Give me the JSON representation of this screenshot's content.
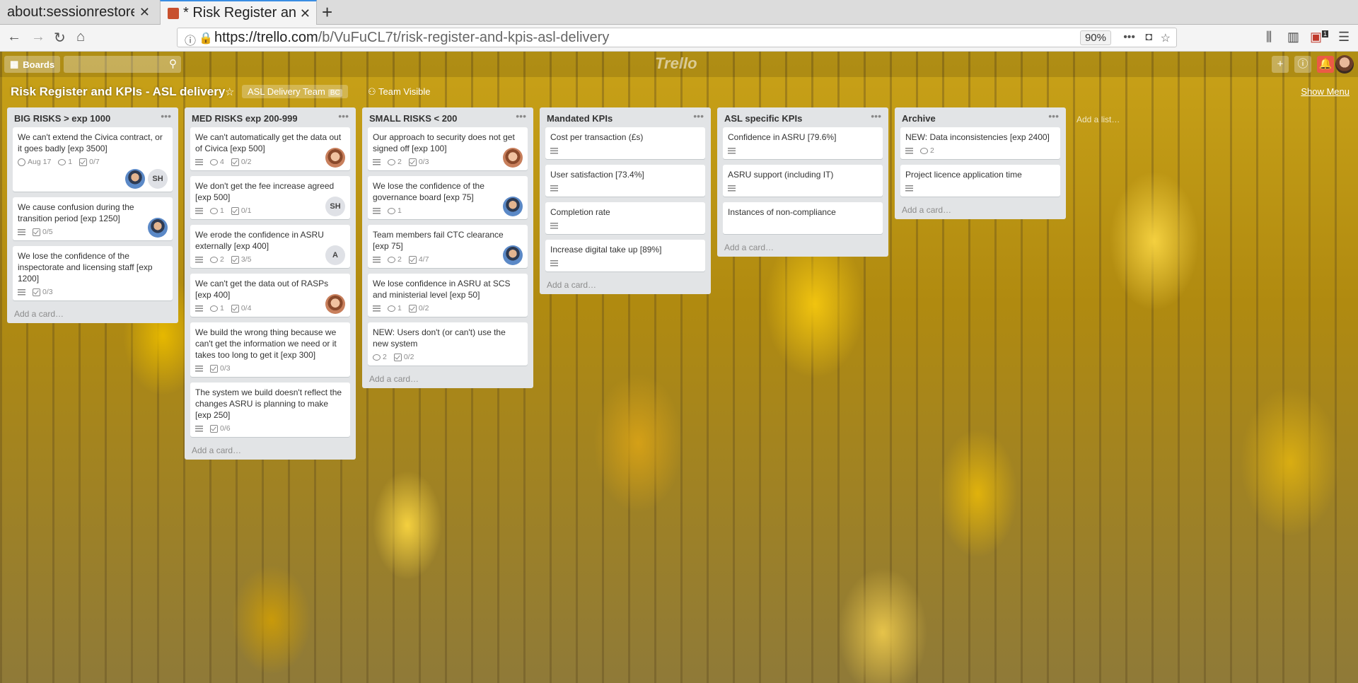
{
  "browser": {
    "tabs": [
      {
        "label": "about:sessionrestore",
        "active": false
      },
      {
        "label": "* Risk Register and KPIs - ASL delivery | Trello",
        "active": true
      }
    ],
    "url_host": "https://trello.com",
    "url_path": "/b/VuFuCL7t/risk-register-and-kpis-asl-delivery",
    "zoom": "90%",
    "extension_badge": "1"
  },
  "header": {
    "boards_label": "Boards",
    "logo": "Trello"
  },
  "board": {
    "title": "Risk Register and KPIs - ASL delivery",
    "team": "ASL Delivery Team",
    "team_tag": "BC",
    "visibility": "Team Visible",
    "show_menu": "Show Menu",
    "add_list": "Add a list…"
  },
  "lists": [
    {
      "name": "BIG RISKS > exp 1000",
      "add_card": "Add a card…",
      "cards": [
        {
          "title": "We can't extend the Civica contract, or it goes badly [exp 3500]",
          "due": "Aug 17",
          "comments": "1",
          "checklist": "0/7",
          "members": [
            "blue",
            "SH"
          ]
        },
        {
          "title": "We cause confusion during the transition period [exp 1250]",
          "desc": true,
          "checklist": "0/5",
          "members": [
            "blue"
          ]
        },
        {
          "title": "We lose the confidence of the inspectorate and licensing staff [exp 1200]",
          "desc": true,
          "checklist": "0/3",
          "members": []
        }
      ]
    },
    {
      "name": "MED RISKS exp 200-999",
      "add_card": "Add a card…",
      "cards": [
        {
          "title": "We can't automatically get the data out of Civica [exp 500]",
          "desc": true,
          "comments": "4",
          "checklist": "0/2",
          "members": [
            "warm"
          ]
        },
        {
          "title": "We don't get the fee increase agreed [exp 500]",
          "desc": true,
          "comments": "1",
          "checklist": "0/1",
          "members": [
            "SH"
          ]
        },
        {
          "title": "We erode the confidence in ASRU externally [exp 400]",
          "desc": true,
          "comments": "2",
          "checklist": "3/5",
          "members": [
            "A"
          ]
        },
        {
          "title": "We can't get the data out of RASPs [exp 400]",
          "desc": true,
          "comments": "1",
          "checklist": "0/4",
          "members": [
            "warm"
          ]
        },
        {
          "title": "We build the wrong thing because we can't get the information we need or it takes too long to get it [exp 300]",
          "desc": true,
          "checklist": "0/3",
          "members": []
        },
        {
          "title": "The system we build doesn't reflect the changes ASRU is planning to make [exp 250]",
          "desc": true,
          "checklist": "0/6",
          "members": []
        }
      ]
    },
    {
      "name": "SMALL RISKS < 200",
      "add_card": "Add a card…",
      "cards": [
        {
          "title": "Our approach to security does not get signed off [exp 100]",
          "desc": true,
          "comments": "2",
          "checklist": "0/3",
          "members": [
            "warm"
          ]
        },
        {
          "title": "We lose the confidence of the governance board [exp 75]",
          "desc": true,
          "comments": "1",
          "members": [
            "blue"
          ]
        },
        {
          "title": "Team members fail CTC clearance [exp 75]",
          "desc": true,
          "comments": "2",
          "checklist": "4/7",
          "members": [
            "blue"
          ]
        },
        {
          "title": "We lose confidence in ASRU at SCS and ministerial level [exp 50]",
          "desc": true,
          "comments": "1",
          "checklist": "0/2",
          "members": []
        },
        {
          "title": "NEW: Users don't (or can't) use the new system",
          "comments": "2",
          "checklist": "0/2",
          "members": []
        }
      ]
    },
    {
      "name": "Mandated KPIs",
      "add_card": "Add a card…",
      "cards": [
        {
          "title": "Cost per transaction (£s)",
          "desc": true,
          "members": []
        },
        {
          "title": "User satisfaction [73.4%]",
          "desc": true,
          "members": []
        },
        {
          "title": "Completion rate",
          "desc": true,
          "members": []
        },
        {
          "title": "Increase digital take up [89%]",
          "desc": true,
          "members": []
        }
      ]
    },
    {
      "name": "ASL specific KPIs",
      "add_card": "Add a card…",
      "cards": [
        {
          "title": "Confidence in ASRU [79.6%]",
          "desc": true,
          "members": []
        },
        {
          "title": "ASRU support (including IT)",
          "desc": true,
          "members": []
        },
        {
          "title": "Instances of non-compliance",
          "members": []
        }
      ]
    },
    {
      "name": "Archive",
      "add_card": "Add a card…",
      "cards": [
        {
          "title": "NEW: Data inconsistencies [exp 2400]",
          "desc": true,
          "comments": "2",
          "members": []
        },
        {
          "title": "Project licence application time",
          "desc": true,
          "members": []
        }
      ]
    }
  ]
}
